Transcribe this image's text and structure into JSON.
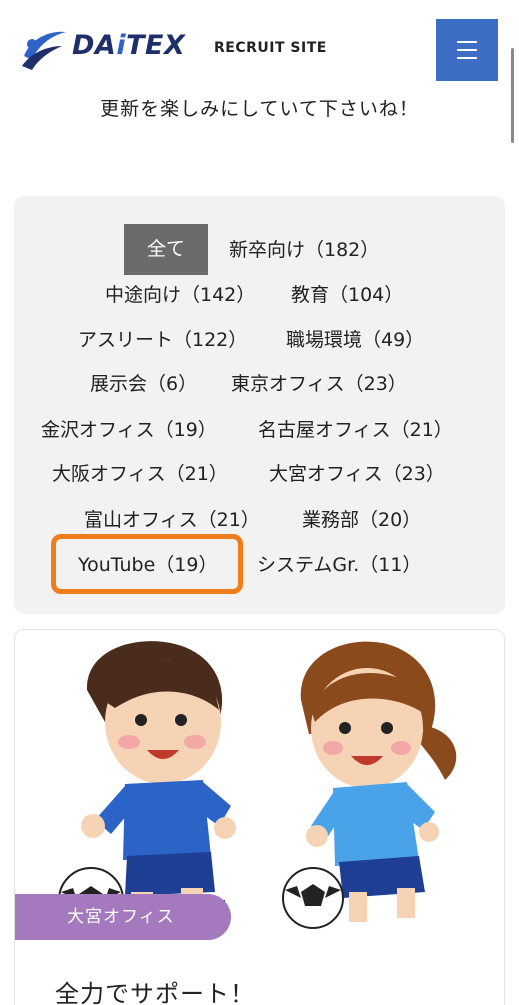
{
  "header": {
    "logo_text_dark": "DA",
    "logo_text_accent": "i",
    "logo_text_end": "TEX",
    "site_label": "RECRUIT SITE"
  },
  "intro_text": "更新を楽しみにしていて下さいね！",
  "filters": [
    {
      "label": "全て"
    },
    {
      "label": "新卒向け（182）"
    },
    {
      "label": "中途向け（142）"
    },
    {
      "label": "教育（104）"
    },
    {
      "label": "アスリート（122）"
    },
    {
      "label": "職場環境（49）"
    },
    {
      "label": "展示会（6）"
    },
    {
      "label": "東京オフィス（23）"
    },
    {
      "label": "金沢オフィス（19）"
    },
    {
      "label": "名古屋オフィス（21）"
    },
    {
      "label": "大阪オフィス（21）"
    },
    {
      "label": "大宮オフィス（23）"
    },
    {
      "label": "富山オフィス（21）"
    },
    {
      "label": "業務部（20）"
    },
    {
      "label": "YouTube（19）"
    },
    {
      "label": "システムGr.（11）"
    }
  ],
  "active_filter": "全て",
  "card": {
    "tag": "大宮オフィス",
    "title": "全力でサポート！"
  },
  "colors": {
    "menu": "#3c6fc4",
    "active_chip": "#6b6b6b",
    "highlight": "#ef7d1a",
    "tag": "#a579be",
    "filter_bg": "#f2f2f2"
  }
}
